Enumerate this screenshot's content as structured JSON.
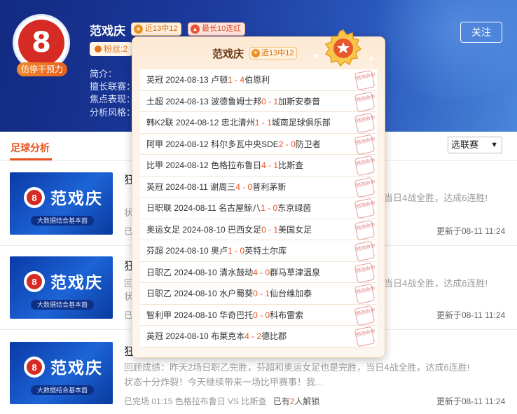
{
  "expert": {
    "name": "范戏庆",
    "avatar_text": "8",
    "avatar_badge": "仿停干预力",
    "tag_streak": "近13中12",
    "tag_longest": "最长10连红",
    "fans_label": "粉丝:2",
    "intro_label": "简介：",
    "league_label": "擅长联赛：",
    "focus_label": "焦点表现：",
    "style_label": "分析风格：",
    "follow": "关注"
  },
  "tabs": {
    "football": "足球分析",
    "league_select": "选联赛"
  },
  "popup": {
    "title": "范戏庆",
    "tag": "近13中12",
    "stamp_text": "预测命中",
    "records": [
      {
        "league": "英冠",
        "date": "2024-08-13",
        "home": "卢顿",
        "hs": "1",
        "as": "4",
        "away": "伯恩利"
      },
      {
        "league": "土超",
        "date": "2024-08-13",
        "home": "波德鲁姆士邦",
        "hs": "0",
        "as": "1",
        "away": "加斯安泰普"
      },
      {
        "league": "韩K2联",
        "date": "2024-08-12",
        "home": "忠北清州",
        "hs": "1",
        "as": "1",
        "away": "城南足球俱乐部"
      },
      {
        "league": "阿甲",
        "date": "2024-08-12",
        "home": "科尔多瓦中央SDE",
        "hs": "2",
        "as": "0",
        "away": "防卫者"
      },
      {
        "league": "比甲",
        "date": "2024-08-12",
        "home": "色格拉布鲁日",
        "hs": "4",
        "as": "1",
        "away": "比斯查"
      },
      {
        "league": "英冠",
        "date": "2024-08-11",
        "home": "谢周三",
        "hs": "4",
        "as": "0",
        "away": "普利茅斯"
      },
      {
        "league": "日职联",
        "date": "2024-08-11",
        "home": "名古屋鲸八",
        "hs": "1",
        "as": "0",
        "away": "东京绿茵"
      },
      {
        "league": "奥运女足",
        "date": "2024-08-10",
        "home": "巴西女足",
        "hs": "0",
        "as": "1",
        "away": "美国女足"
      },
      {
        "league": "芬超",
        "date": "2024-08-10",
        "home": "奥卢",
        "hs": "1",
        "as": "0",
        "away": "英特土尔库"
      },
      {
        "league": "日职乙",
        "date": "2024-08-10",
        "home": "清水鼓动",
        "hs": "4",
        "as": "0",
        "away": "群马草津温泉"
      },
      {
        "league": "日职乙",
        "date": "2024-08-10",
        "home": "水户蜀葵",
        "hs": "0",
        "as": "1",
        "away": "仙台维加泰"
      },
      {
        "league": "智利甲",
        "date": "2024-08-10",
        "home": "华奇巴托",
        "hs": "0",
        "as": "0",
        "away": "科布雷索"
      },
      {
        "league": "英冠",
        "date": "2024-08-10",
        "home": "布莱克本",
        "hs": "4",
        "as": "2",
        "away": "德比郡"
      }
    ]
  },
  "articles": [
    {
      "thumb_name": "范戏庆",
      "thumb_sub": "大数据结合基本面",
      "title": "狂",
      "body_right": "当日4战全胜，达成6连胜!",
      "body_left2": "状",
      "meta_left": "已",
      "updated": "更新于08-11 11:24"
    },
    {
      "thumb_name": "范戏庆",
      "thumb_sub": "大数据结合基本面",
      "title": "狂",
      "body_left": "回",
      "body_right": "当日4战全胜，达成6连胜!",
      "body_left2": "状",
      "meta_left": "已",
      "updated": "更新于08-11 11:24"
    },
    {
      "thumb_name": "范戏庆",
      "thumb_sub": "大数据结合基本面",
      "title": "狂",
      "body_line1": "回顾成绩：昨天2场日职乙完胜，芬超和奥运女足也是完胜，当日4战全胜，达成6连胜!",
      "body_line2": "状态十分炸裂！今天继续带来一场比甲赛事！我...",
      "meta_status": "已完场 01:15 色格拉布鲁日 VS 比斯查",
      "meta_has": "已有",
      "meta_count": "2",
      "meta_unlock": "人解锁",
      "updated": "更新于08-11 11:24"
    }
  ]
}
